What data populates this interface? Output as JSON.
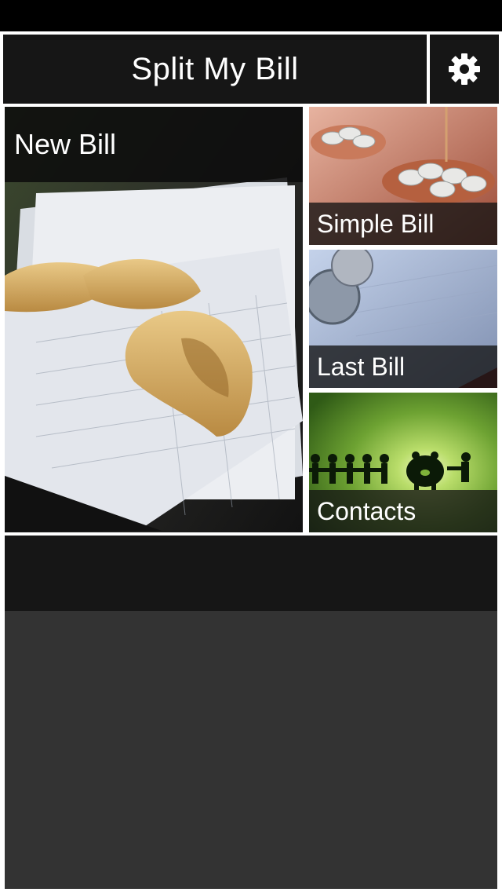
{
  "app": {
    "title": "Split My Bill"
  },
  "header": {
    "settings_icon": "gear-icon"
  },
  "tiles": {
    "new_bill": {
      "label": "New Bill",
      "image": "fortune-cookies-on-receipts-photo"
    },
    "simple_bill": {
      "label": "Simple Bill",
      "image": "coins-on-scale-photo"
    },
    "last_bill": {
      "label": "Last Bill",
      "image": "coins-on-receipt-photo"
    },
    "contacts": {
      "label": "Contacts",
      "image": "paper-people-piggy-bank-illustration"
    }
  },
  "colors": {
    "background": "#000000",
    "frame": "#ffffff",
    "bar": "#161616",
    "panel": "#333333",
    "text": "#ffffff",
    "contacts_green": "#7fb33a"
  }
}
